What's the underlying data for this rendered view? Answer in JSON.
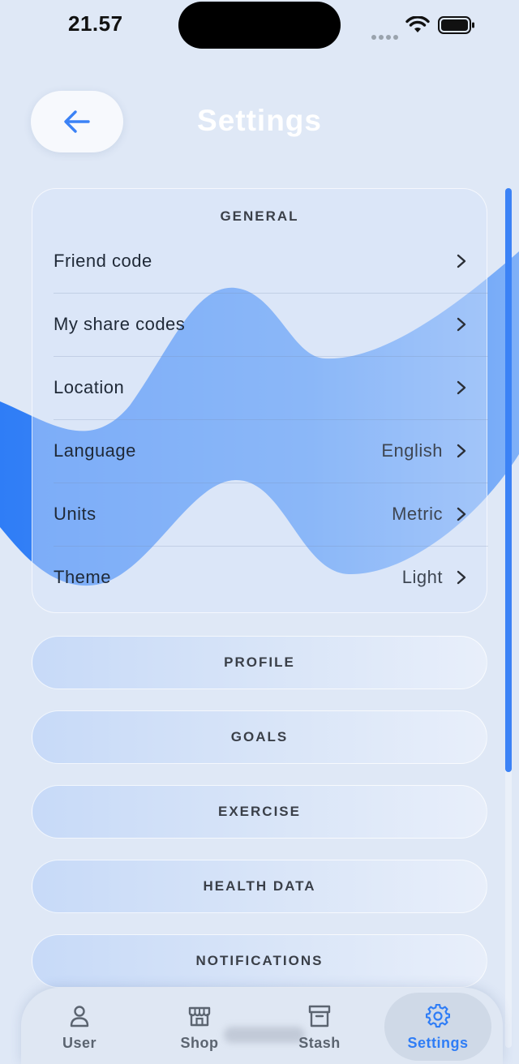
{
  "status_bar": {
    "time": "21.57"
  },
  "header": {
    "title": "Settings",
    "back_icon": "arrow-left-icon"
  },
  "general": {
    "title": "GENERAL",
    "items": [
      {
        "label": "Friend code",
        "value": ""
      },
      {
        "label": "My share codes",
        "value": ""
      },
      {
        "label": "Location",
        "value": ""
      },
      {
        "label": "Language",
        "value": "English"
      },
      {
        "label": "Units",
        "value": "Metric"
      },
      {
        "label": "Theme",
        "value": "Light"
      }
    ]
  },
  "sections": [
    "PROFILE",
    "GOALS",
    "EXERCISE",
    "HEALTH DATA",
    "NOTIFICATIONS"
  ],
  "tab_bar": {
    "items": [
      {
        "label": "User",
        "icon": "user-icon",
        "active": false
      },
      {
        "label": "Shop",
        "icon": "shop-icon",
        "active": false
      },
      {
        "label": "Stash",
        "icon": "archive-box-icon",
        "active": false
      },
      {
        "label": "Settings",
        "icon": "gear-icon",
        "active": true
      }
    ]
  },
  "colors": {
    "accent": "#3b82f6",
    "background": "#dfe8f6",
    "wave": "#3b82f6"
  }
}
